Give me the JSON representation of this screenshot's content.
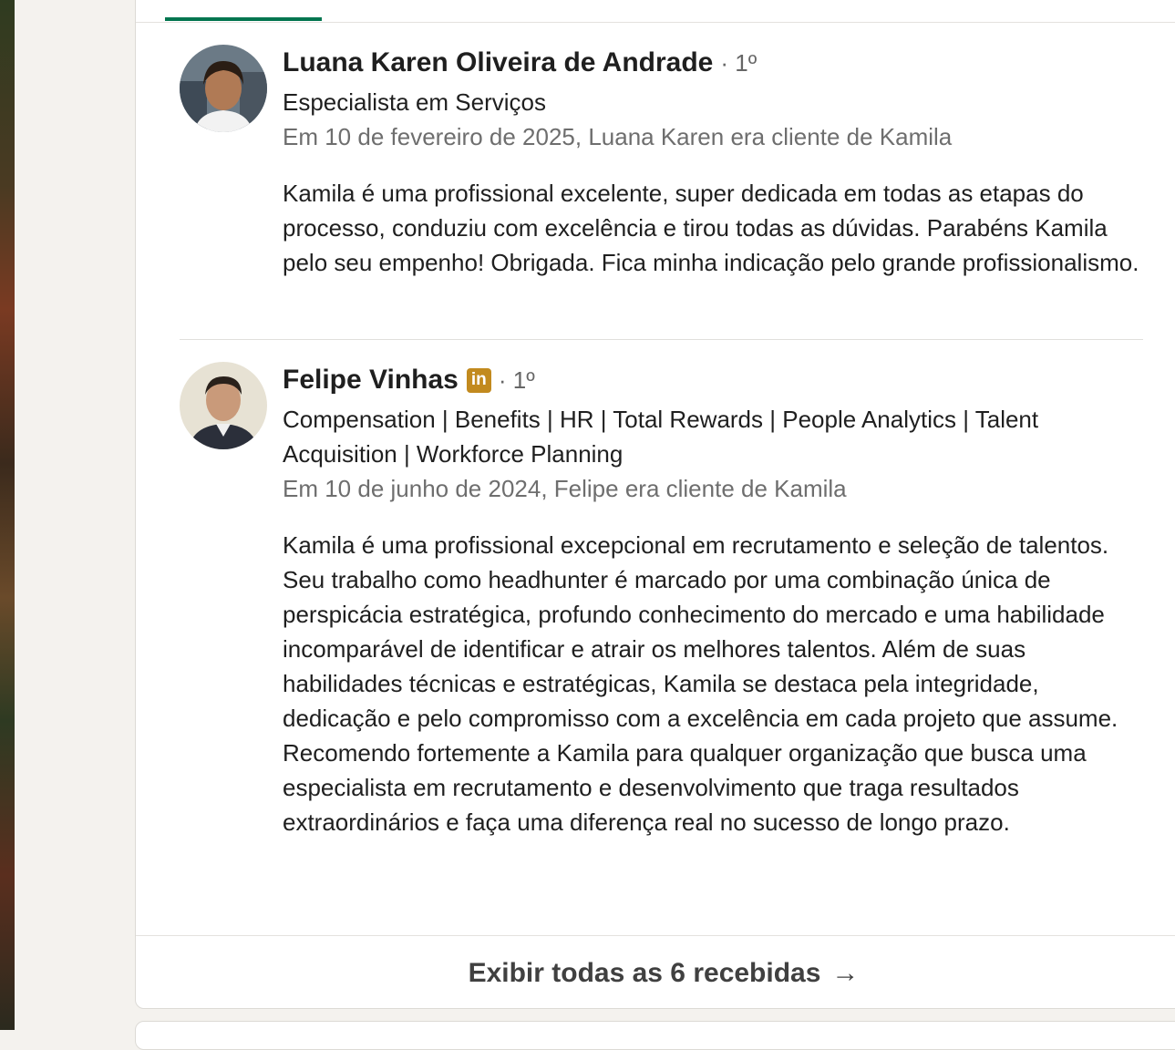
{
  "recommendations": [
    {
      "name": "Luana Karen Oliveira de Andrade",
      "degree": "· 1º",
      "headline": "Especialista em Serviços",
      "meta": "Em 10 de fevereiro de 2025, Luana Karen era cliente de Kamila",
      "text": "Kamila é uma profissional excelente, super dedicada em todas as etapas do processo, conduziu com excelência e tirou todas as dúvidas. Parabéns Kamila pelo seu empenho! Obrigada. Fica minha indicação pelo grande profissionalismo."
    },
    {
      "name": "Felipe Vinhas",
      "badge": "in",
      "degree": "· 1º",
      "headline": "Compensation | Benefits | HR | Total Rewards | People Analytics | Talent Acquisition | Workforce Planning",
      "meta": "Em 10 de junho de 2024, Felipe era cliente de Kamila",
      "text": "Kamila é uma profissional excepcional em recrutamento e seleção de talentos. Seu trabalho como headhunter é marcado por uma combinação única de perspicácia estratégica, profundo conhecimento do mercado e uma habilidade incomparável de identificar e atrair os melhores talentos. Além de suas habilidades técnicas e estratégicas, Kamila se destaca pela integridade, dedicação e pelo compromisso com a excelência em cada projeto que assume.\nRecomendo fortemente a Kamila para qualquer organização que busca uma especialista em recrutamento e desenvolvimento que traga resultados extraordinários e faça uma diferença real no sucesso de longo prazo."
    }
  ],
  "footer": {
    "show_all": "Exibir todas as 6 recebidas",
    "arrow": "→"
  },
  "colors": {
    "accent_tab": "#01754f",
    "premium_badge": "#c28a1e"
  }
}
